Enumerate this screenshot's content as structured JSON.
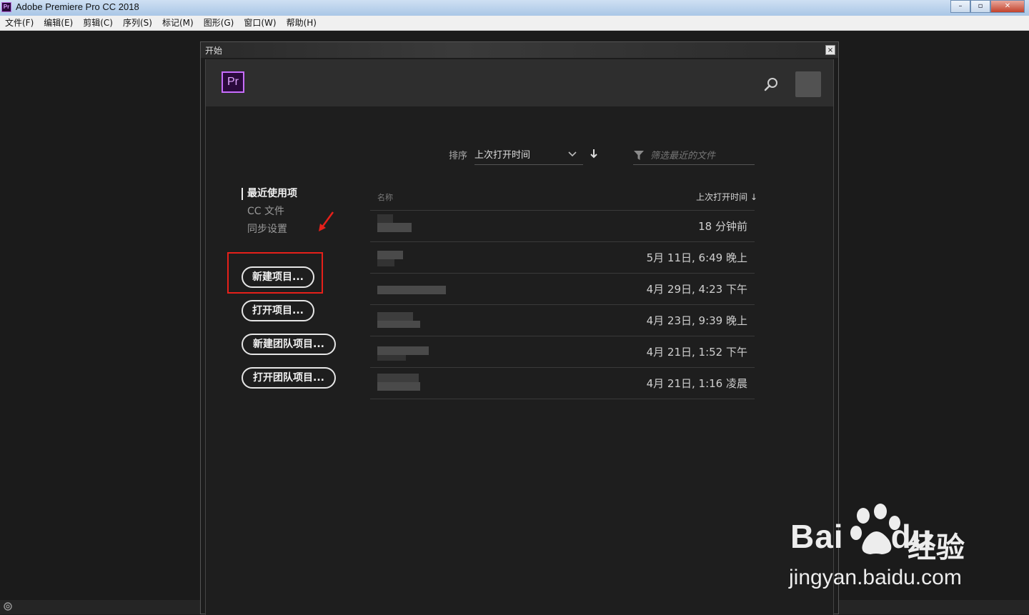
{
  "window": {
    "app_title": "Adobe Premiere Pro CC 2018",
    "app_icon_label": "Pr",
    "minimize": "–",
    "restore": "▫",
    "close": "✕"
  },
  "menu": [
    "文件(F)",
    "编辑(E)",
    "剪辑(C)",
    "序列(S)",
    "标记(M)",
    "图形(G)",
    "窗口(W)",
    "帮助(H)"
  ],
  "dialog": {
    "title": "开始",
    "close": "×",
    "logo": "Pr"
  },
  "sort": {
    "label": "排序",
    "value": "上次打开时间",
    "filter_placeholder": "筛选最近的文件"
  },
  "nav": {
    "items": [
      "最近使用项",
      "CC 文件",
      "同步设置"
    ],
    "active_index": 0
  },
  "buttons": {
    "new_project": "新建项目...",
    "open_project": "打开项目...",
    "new_team_project": "新建团队项目...",
    "open_team_project": "打开团队项目..."
  },
  "recent": {
    "col_name": "名称",
    "col_time": "上次打开时间",
    "rows": [
      {
        "time": "18 分钟前"
      },
      {
        "time": "5月 11日, 6:49 晚上"
      },
      {
        "time": "4月 29日, 4:23 下午"
      },
      {
        "time": "4月 23日, 9:39 晚上"
      },
      {
        "time": "4月 21日, 1:52 下午"
      },
      {
        "time": "4月 21日, 1:16 凌晨"
      }
    ]
  },
  "watermark": {
    "brand": "Bai",
    "brand_suffix": "du",
    "cn": "经验",
    "url": "jingyan.baidu.com"
  }
}
